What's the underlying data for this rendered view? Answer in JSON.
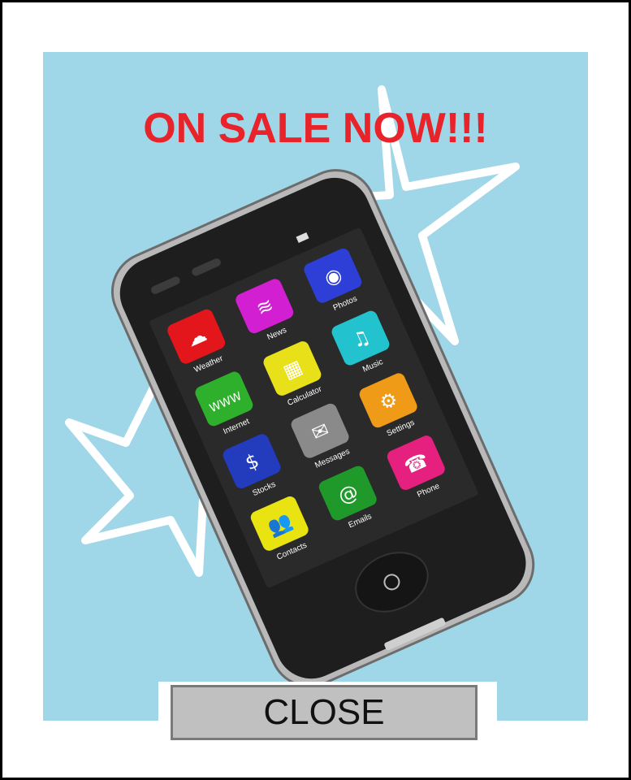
{
  "ad": {
    "headline": "ON SALE NOW!!!",
    "close_label": "CLOSE",
    "colors": {
      "panel": "#9fd7e8",
      "headline": "#e8232a",
      "button": "#c0c0c0"
    }
  },
  "phone": {
    "apps": [
      {
        "label": "Weather",
        "icon": "weather-icon",
        "color": "#e3161b"
      },
      {
        "label": "News",
        "icon": "wifi-icon",
        "color": "#d11fd1"
      },
      {
        "label": "Photos",
        "icon": "camera-icon",
        "color": "#2d3fd6"
      },
      {
        "label": "Internet",
        "icon": "www-icon",
        "color": "#2fb02c"
      },
      {
        "label": "Calculator",
        "icon": "calculator-icon",
        "color": "#e8e11a"
      },
      {
        "label": "Music",
        "icon": "music-icon",
        "color": "#22c2cf"
      },
      {
        "label": "Stocks",
        "icon": "dollar-icon",
        "color": "#233bbd"
      },
      {
        "label": "Messages",
        "icon": "envelope-icon",
        "color": "#8a8a8a"
      },
      {
        "label": "Settings",
        "icon": "gears-icon",
        "color": "#f09b17"
      },
      {
        "label": "Contacts",
        "icon": "people-icon",
        "color": "#e9e312"
      },
      {
        "label": "Emails",
        "icon": "at-icon",
        "color": "#1f9a2a"
      },
      {
        "label": "Phone",
        "icon": "handset-icon",
        "color": "#e6207e"
      }
    ]
  }
}
